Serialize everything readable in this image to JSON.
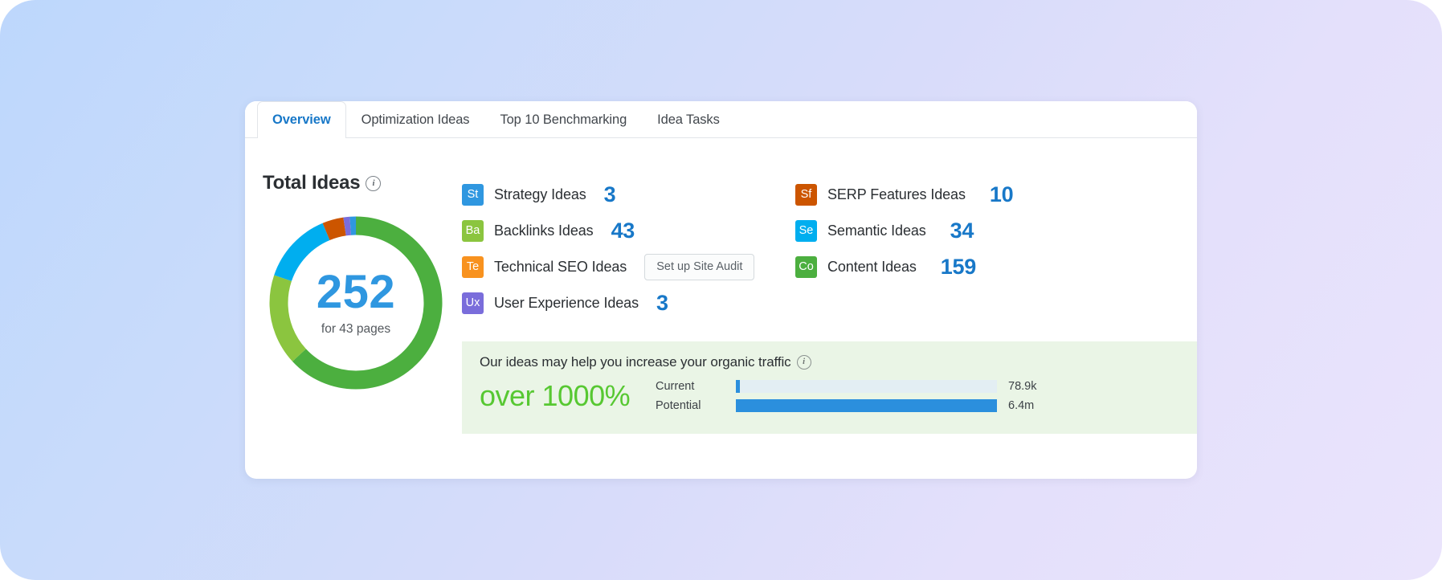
{
  "background": {
    "from": "#bdd7fc",
    "to": "#eae4fc"
  },
  "tabs": [
    {
      "label": "Overview",
      "active": true
    },
    {
      "label": "Optimization Ideas",
      "active": false
    },
    {
      "label": "Top 10 Benchmarking",
      "active": false
    },
    {
      "label": "Idea Tasks",
      "active": false
    }
  ],
  "section": {
    "title": "Total Ideas",
    "info_icon": "info-icon",
    "info_glyph": "i"
  },
  "donut": {
    "total": "252",
    "subtitle": "for 43 pages"
  },
  "metrics_left": [
    {
      "code": "St",
      "color": "#2f97e0",
      "label": "Strategy Ideas",
      "value": "3",
      "type": "value"
    },
    {
      "code": "Ba",
      "color": "#8bc53f",
      "label": "Backlinks Ideas",
      "value": "43",
      "type": "value"
    },
    {
      "code": "Te",
      "color": "#f8921f",
      "label": "Technical SEO Ideas",
      "value": "Set up Site Audit",
      "type": "button"
    },
    {
      "code": "Ux",
      "color": "#7a6ddb",
      "label": "User Experience Ideas",
      "value": "3",
      "type": "value"
    }
  ],
  "metrics_right": [
    {
      "code": "Sf",
      "color": "#cc5500",
      "label": "SERP Features Ideas",
      "value": "10",
      "type": "value"
    },
    {
      "code": "Se",
      "color": "#00aeef",
      "label": "Semantic Ideas",
      "value": "34",
      "type": "value"
    },
    {
      "code": "Co",
      "color": "#4caf3f",
      "label": "Content Ideas",
      "value": "159",
      "type": "value"
    }
  ],
  "traffic": {
    "headline": "Our ideas may help you increase your organic traffic",
    "info_glyph": "i",
    "percent": "over 1000%",
    "percent_color": "#57c832",
    "rows": [
      {
        "label": "Current",
        "value": "78.9k",
        "fill_pct": 1.4
      },
      {
        "label": "Potential",
        "value": "6.4m",
        "fill_pct": 100
      }
    ]
  },
  "chart_data": {
    "type": "pie",
    "title": "Total Ideas",
    "center_value": 252,
    "center_label": "for 43 pages",
    "categories": [
      "Content Ideas",
      "Backlinks Ideas",
      "Semantic Ideas",
      "SERP Features Ideas",
      "User Experience Ideas",
      "Strategy Ideas",
      "Technical SEO Ideas"
    ],
    "values": [
      159,
      43,
      34,
      10,
      3,
      3,
      0
    ],
    "colors": [
      "#4caf3f",
      "#8bc53f",
      "#00aeef",
      "#cc5500",
      "#7a6ddb",
      "#2f97e0",
      "#f8921f"
    ],
    "total": 252,
    "legend_position": "right",
    "grid": false
  }
}
